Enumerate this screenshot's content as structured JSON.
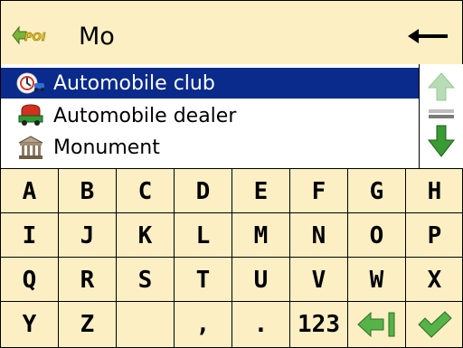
{
  "search": {
    "query": "Mo"
  },
  "results": [
    {
      "label": "Automobile club",
      "icon": "automobile-club-icon",
      "selected": true
    },
    {
      "label": "Automobile dealer",
      "icon": "automobile-dealer-icon",
      "selected": false
    },
    {
      "label": "Monument",
      "icon": "monument-icon",
      "selected": false
    }
  ],
  "keyboard": {
    "rows": [
      [
        "A",
        "B",
        "C",
        "D",
        "E",
        "F",
        "G",
        "H"
      ],
      [
        "I",
        "J",
        "K",
        "L",
        "M",
        "N",
        "O",
        "P"
      ],
      [
        "Q",
        "R",
        "S",
        "T",
        "U",
        "V",
        "W",
        "X"
      ],
      [
        "Y",
        "Z",
        "",
        ",",
        ".",
        "123",
        "",
        ""
      ]
    ]
  },
  "colors": {
    "background": "#fcefc4",
    "selection": "#0a2a8c",
    "scroll_up_disabled": "#b7ddb4",
    "scroll_down": "#3a9a33",
    "confirm_green": "#55b348"
  }
}
